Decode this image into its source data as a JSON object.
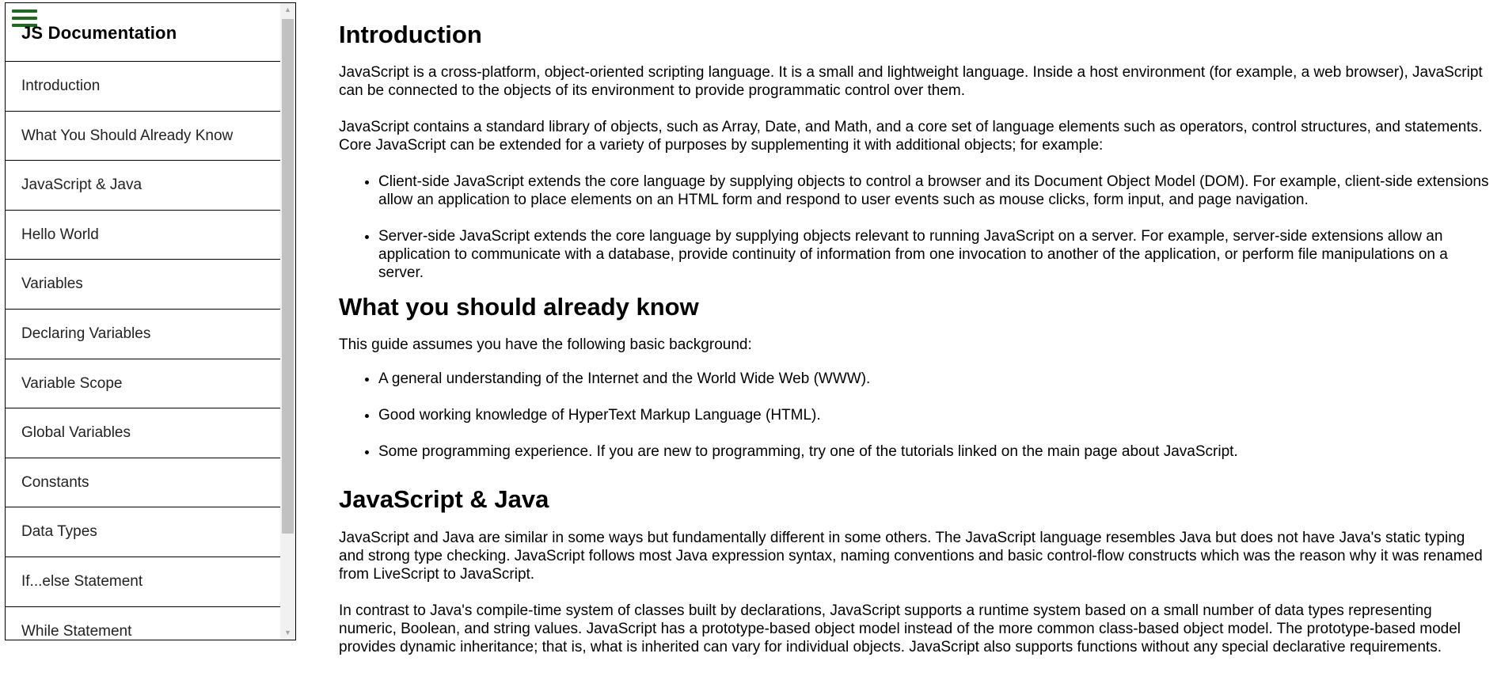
{
  "sidebar": {
    "title": "JS Documentation",
    "items": [
      {
        "label": "Introduction"
      },
      {
        "label": "What You Should Already Know"
      },
      {
        "label": "JavaScript & Java"
      },
      {
        "label": "Hello World"
      },
      {
        "label": "Variables"
      },
      {
        "label": "Declaring Variables"
      },
      {
        "label": "Variable Scope"
      },
      {
        "label": "Global Variables"
      },
      {
        "label": "Constants"
      },
      {
        "label": "Data Types"
      },
      {
        "label": "If...else Statement"
      },
      {
        "label": "While Statement"
      }
    ]
  },
  "colors": {
    "hamburger": "#1a6e1a"
  },
  "icons": {
    "menu": "hamburger-menu-icon",
    "scroll_up": "scroll-up-arrow-icon",
    "scroll_down": "scroll-down-arrow-icon"
  },
  "main": {
    "intro": {
      "title": "Introduction",
      "p1": "JavaScript is a cross-platform, object-oriented scripting language. It is a small and lightweight language. Inside a host environment (for example, a web browser), JavaScript can be connected to the objects of its environment to provide programmatic control over them.",
      "p2": "JavaScript contains a standard library of objects, such as Array, Date, and Math, and a core set of language elements such as operators, control structures, and statements. Core JavaScript can be extended for a variety of purposes by supplementing it with additional objects; for example:",
      "bullets": [
        "Client-side JavaScript extends the core language by supplying objects to control a browser and its Document Object Model (DOM). For example, client-side extensions allow an application to place elements on an HTML form and respond to user events such as mouse clicks, form input, and page navigation.",
        "Server-side JavaScript extends the core language by supplying objects relevant to running JavaScript on a server. For example, server-side extensions allow an application to communicate with a database, provide continuity of information from one invocation to another of the application, or perform file manipulations on a server."
      ]
    },
    "know": {
      "title": "What you should already know",
      "p1": "This guide assumes you have the following basic background:",
      "bullets": [
        "A general understanding of the Internet and the World Wide Web (WWW).",
        "Good working knowledge of HyperText Markup Language (HTML).",
        "Some programming experience. If you are new to programming, try one of the tutorials linked on the main page about JavaScript."
      ]
    },
    "java": {
      "title": "JavaScript & Java",
      "p1": "JavaScript and Java are similar in some ways but fundamentally different in some others. The JavaScript language resembles Java but does not have Java's static typing and strong type checking. JavaScript follows most Java expression syntax, naming conventions and basic control-flow constructs which was the reason why it was renamed from LiveScript to JavaScript.",
      "p2": "In contrast to Java's compile-time system of classes built by declarations, JavaScript supports a runtime system based on a small number of data types representing numeric, Boolean, and string values. JavaScript has a prototype-based object model instead of the more common class-based object model. The prototype-based model provides dynamic inheritance; that is, what is inherited can vary for individual objects. JavaScript also supports functions without any special declarative requirements."
    }
  }
}
